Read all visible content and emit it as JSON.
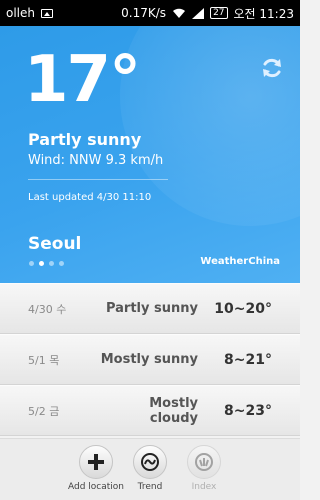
{
  "statusbar": {
    "carrier": "olleh",
    "speed": "0.17K/s",
    "battery": "27",
    "time": "오전 11:23"
  },
  "weather": {
    "temperature": "17°",
    "condition": "Partly sunny",
    "wind": "Wind: NNW 9.3 km/h",
    "updated": "Last updated 4/30 11:10",
    "city": "Seoul",
    "brand": "WeatherChina",
    "page_count": 4,
    "active_page": 2
  },
  "forecast": [
    {
      "date": "4/30 수",
      "condition": "Partly sunny",
      "range": "10~20°"
    },
    {
      "date": "5/1 목",
      "condition": "Mostly sunny",
      "range": "8~21°"
    },
    {
      "date": "5/2 금",
      "condition": "Mostly cloudy",
      "range": "8~23°"
    }
  ],
  "toolbar": {
    "add_location": "Add location",
    "trend": "Trend",
    "index": "Index"
  },
  "colors": {
    "hero_bg": "#3aa3ee",
    "hero_text": "#ffffff"
  }
}
